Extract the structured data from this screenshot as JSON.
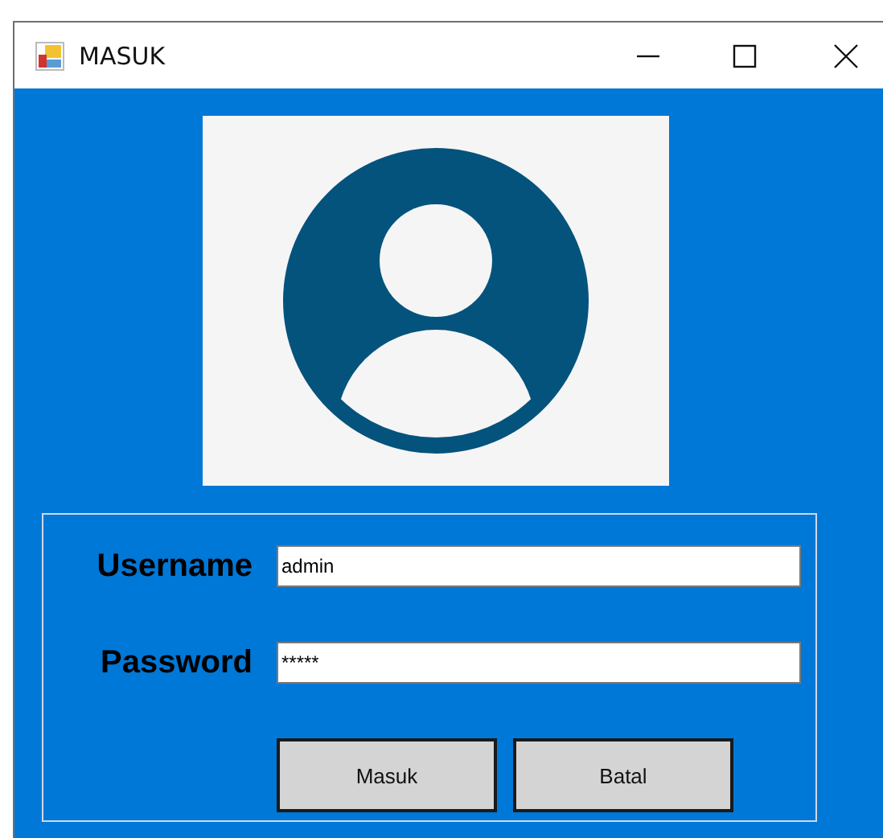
{
  "window": {
    "title": "MASUK"
  },
  "form": {
    "fields": [
      {
        "label": "Username",
        "value": "admin"
      },
      {
        "label": "Password",
        "value": "*****"
      }
    ],
    "buttons": [
      "Masuk",
      "Batal"
    ]
  }
}
